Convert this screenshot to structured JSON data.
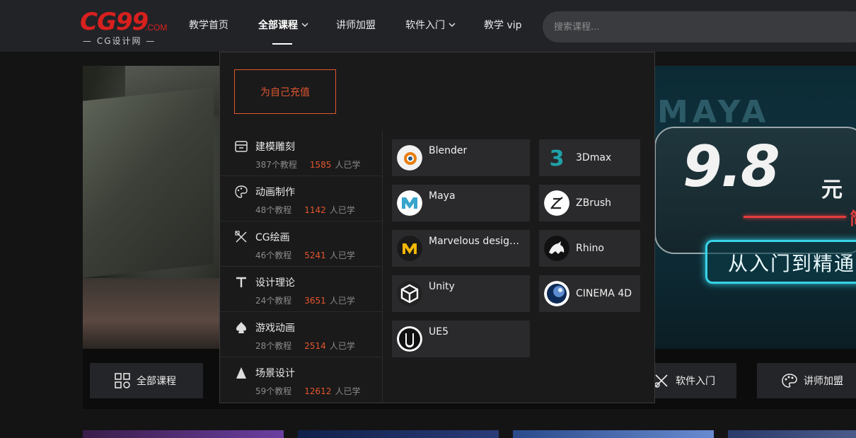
{
  "header": {
    "logo_main": "CG99",
    "logo_com": ".COM",
    "logo_sub": "— CG设计网 —",
    "nav": [
      {
        "label": "教学首页"
      },
      {
        "label": "全部课程"
      },
      {
        "label": "讲师加盟"
      },
      {
        "label": "软件入门"
      },
      {
        "label": "教学 vip"
      }
    ],
    "search_placeholder": "搜索课程..."
  },
  "banner": {
    "maya_text": "MAYA",
    "price": "9.8",
    "price_unit": "元",
    "red_char": "简",
    "slogan": "从入门到精通"
  },
  "quickbar": {
    "all_courses": "全部课程",
    "software_intro": "软件入门",
    "lecturer_join": "讲师加盟"
  },
  "dropdown": {
    "recharge": "为自己充值",
    "categories": [
      {
        "name": "建模雕刻",
        "count": "387个教程",
        "learners": "1585",
        "suffix": "人已学"
      },
      {
        "name": "动画制作",
        "count": "48个教程",
        "learners": "1142",
        "suffix": "人已学"
      },
      {
        "name": "CG绘画",
        "count": "46个教程",
        "learners": "5241",
        "suffix": "人已学"
      },
      {
        "name": "设计理论",
        "count": "24个教程",
        "learners": "3651",
        "suffix": "人已学"
      },
      {
        "name": "游戏动画",
        "count": "28个教程",
        "learners": "2514",
        "suffix": "人已学"
      },
      {
        "name": "场景设计",
        "count": "59个教程",
        "learners": "12612",
        "suffix": "人已学"
      }
    ],
    "software": [
      {
        "name": "Blender",
        "icon": "blender-icon"
      },
      {
        "name": "3Dmax",
        "icon": "3dsmax-icon"
      },
      {
        "name": "Maya",
        "icon": "maya-icon"
      },
      {
        "name": "ZBrush",
        "icon": "zbrush-icon"
      },
      {
        "name": "Marvelous design...",
        "icon": "marvelous-designer-icon"
      },
      {
        "name": "Rhino",
        "icon": "rhino-icon"
      },
      {
        "name": "Unity",
        "icon": "unity-icon"
      },
      {
        "name": "CINEMA 4D",
        "icon": "cinema4d-icon"
      },
      {
        "name": "UE5",
        "icon": "unreal-icon"
      }
    ]
  },
  "colors": {
    "accent": "#e5552c",
    "brand_red": "#d8201e",
    "header_bg": "#222327",
    "dropdown_bg": "#1a1a1b"
  }
}
